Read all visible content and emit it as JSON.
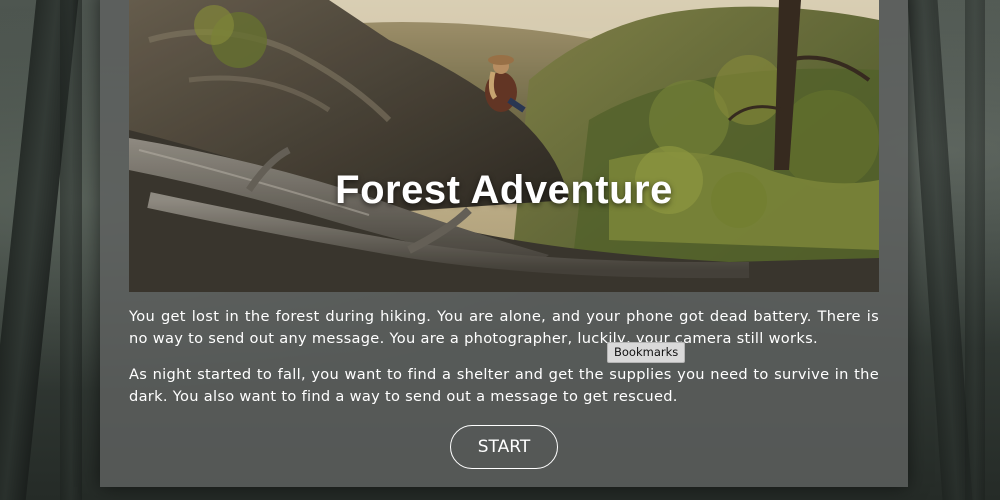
{
  "game": {
    "title": "Forest Adventure",
    "paragraphs": [
      "You get lost in the forest during hiking. You are alone, and your phone got dead battery. There is no way to send out any message. You are a photographer, luckily, your camera still works.",
      "As night started to fall, you want to find a shelter and get the supplies you need to survive in the dark. You also want to find a way to send out a message to get rescued."
    ],
    "start_label": "START"
  },
  "tooltip": {
    "text": "Bookmarks"
  },
  "colors": {
    "panel": "#5f6260",
    "text": "#ffffff",
    "button_border": "#ffffff"
  }
}
